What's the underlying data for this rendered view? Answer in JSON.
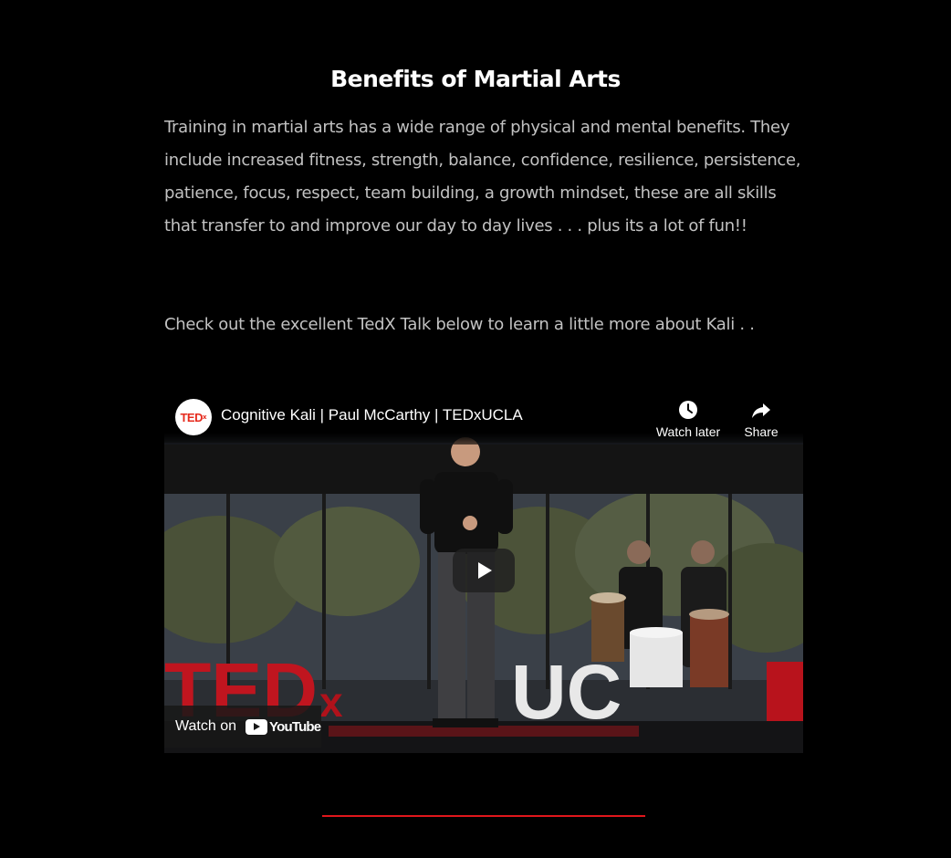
{
  "section": {
    "heading": "Benefits of Martial Arts",
    "paragraph1": "Training in martial arts has a wide range of physical and mental benefits. They include increased fitness, strength, balance, confidence, resilience, persistence, patience, focus, respect, team building, a growth mindset, these are all skills that transfer to and improve our day to day lives . . . plus its a lot of fun!!",
    "paragraph2": "Check out the excellent TedX Talk below to learn a little more about Kali . ."
  },
  "video": {
    "channel_logo_text": "TED",
    "channel_logo_sup": "x",
    "title": "Cognitive Kali | Paul McCarthy | TEDxUCLA",
    "watch_later_label": "Watch later",
    "share_label": "Share",
    "watch_on_label": "Watch on",
    "youtube_wordmark": "YouTube",
    "stage_sign_text": "TEDxUCLA",
    "icons": {
      "channel": "tedx-logo-icon",
      "watch_later": "clock-icon",
      "share": "share-arrow-icon",
      "play": "play-icon",
      "youtube": "youtube-logo-icon"
    }
  },
  "colors": {
    "background": "#000000",
    "heading": "#ffffff",
    "body_text": "#c2c2c2",
    "divider": "#e0161b",
    "tedx_red": "#e62b1e"
  }
}
